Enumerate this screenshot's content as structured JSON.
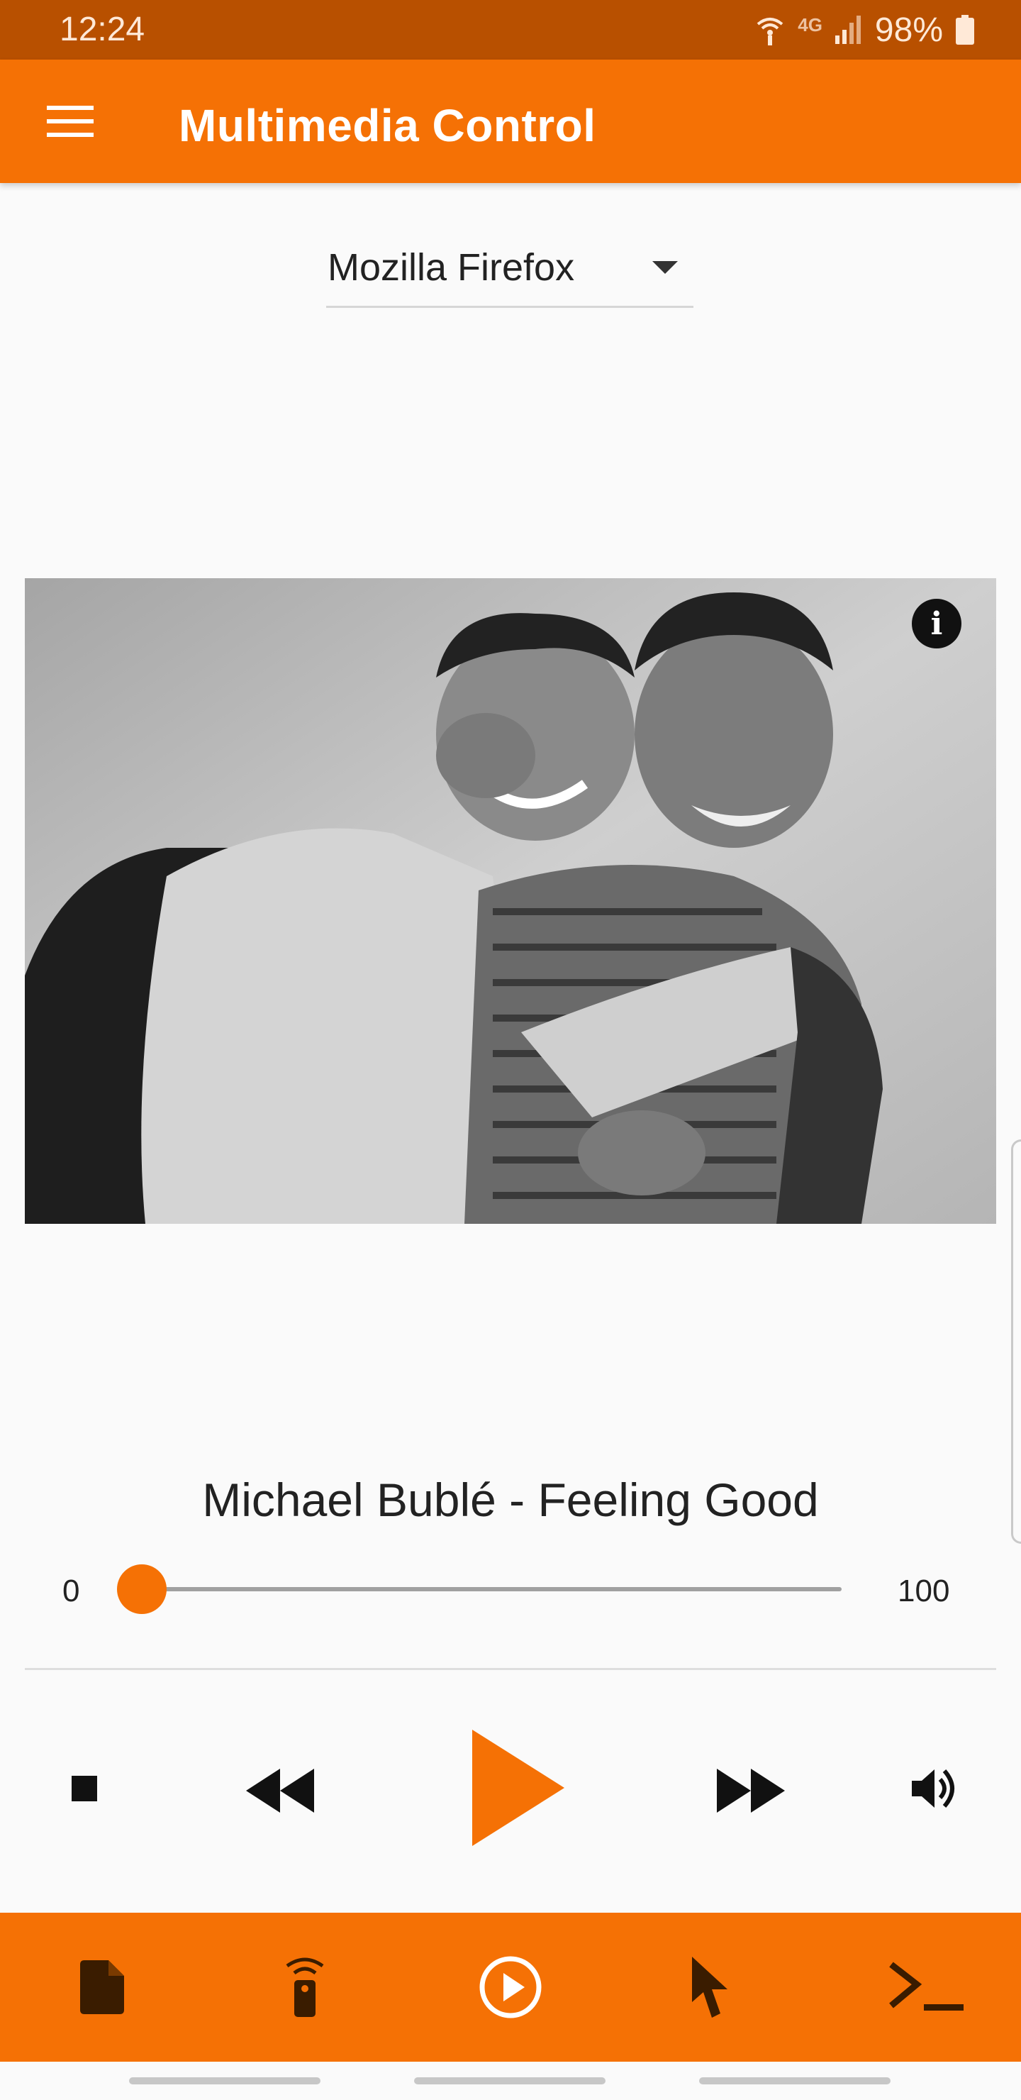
{
  "status_bar": {
    "time": "12:24",
    "network": "4G",
    "battery": "98%"
  },
  "app_bar": {
    "title": "Multimedia Control",
    "menu_icon": "hamburger-menu-icon"
  },
  "player_select": {
    "value": "Mozilla Firefox"
  },
  "now_playing": {
    "title": "Michael Bublé - Feeling Good",
    "seek_min": "0",
    "seek_max": "100",
    "position": 0
  },
  "controls": {
    "stop": "stop-icon",
    "rewind": "rewind-icon",
    "play": "play-icon",
    "fast_forward": "fast-forward-icon",
    "volume": "volume-icon"
  },
  "bottom_nav": {
    "items": [
      "file-icon",
      "remote-icon",
      "play-circle-icon",
      "pointer-icon",
      "terminal-icon"
    ]
  },
  "colors": {
    "accent": "#f57105",
    "status_bar": "#b85000",
    "background": "#fafafa"
  }
}
